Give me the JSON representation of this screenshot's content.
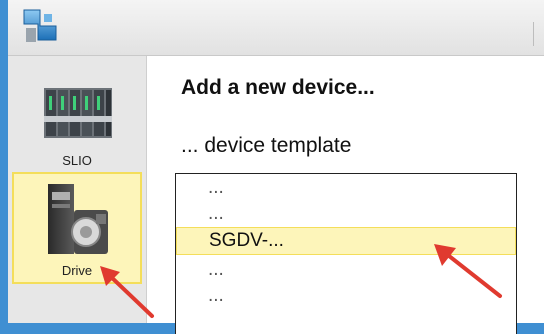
{
  "sidebar": {
    "items": [
      {
        "label": "SLIO",
        "icon": "slio-module-icon",
        "selected": false
      },
      {
        "label": "Drive",
        "icon": "servo-drive-icon",
        "selected": true
      }
    ]
  },
  "main": {
    "heading": "Add a new device...",
    "subheading": "... device template",
    "templates": [
      "...",
      "...",
      "SGDV-...",
      "...",
      "..."
    ],
    "selected_index": 2
  },
  "colors": {
    "frame": "#3f8fd2",
    "selection_fill": "#fdf5ba",
    "selection_border": "#f4de5a",
    "arrow": "#e03a2f"
  }
}
